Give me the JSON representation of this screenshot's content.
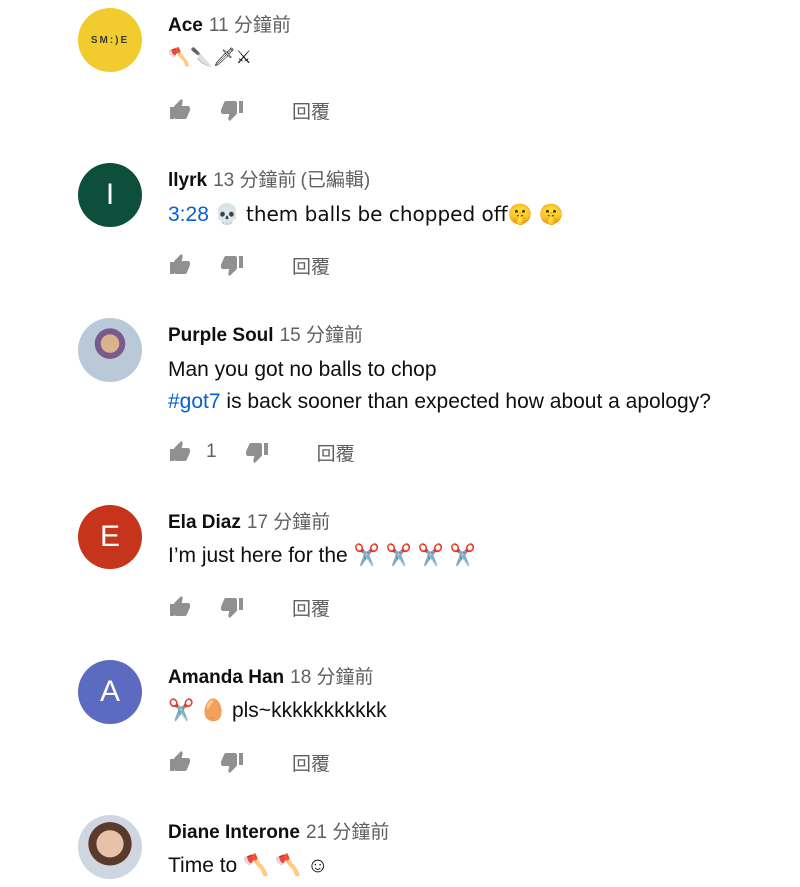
{
  "reply_label": "回覆",
  "comments": [
    {
      "author": "Ace",
      "time": "11 分鐘前",
      "edited": "",
      "avatar_text": "SM:)E",
      "avatar_color": "#f2cc2e",
      "text_line1": "🪓🔪🗡⚔",
      "like_count": ""
    },
    {
      "author": "llyrk",
      "time": "13 分鐘前",
      "edited": "(已編輯)",
      "avatar_text": "I",
      "avatar_color": "#0e4f3c",
      "timestamp_link": "3:28",
      "text_line1": "💀  them balls be chopped off🤫 🤫",
      "like_count": ""
    },
    {
      "author": "Purple Soul",
      "time": "15 分鐘前",
      "edited": "",
      "avatar_text": "",
      "text_line1": "Man you got no balls to chop",
      "hashtag": "#got7",
      "text_line2": " is back sooner than expected how about a apology?",
      "like_count": "1"
    },
    {
      "author": "Ela Diaz",
      "time": "17 分鐘前",
      "edited": "",
      "avatar_text": "E",
      "avatar_color": "#c6341c",
      "text_line1": "I’m just here for the ✂️ ✂️ ✂️ ✂️",
      "like_count": ""
    },
    {
      "author": "Amanda Han",
      "time": "18 分鐘前",
      "edited": "",
      "avatar_text": "A",
      "avatar_color": "#5c6bc0",
      "text_line1": "✂️ 🥚 pls~kkkkkkkkkkk",
      "like_count": ""
    },
    {
      "author": "Diane Interone",
      "time": "21 分鐘前",
      "edited": "",
      "avatar_text": "",
      "text_line1": "Time to 🪓 🪓 ☺",
      "like_count": ""
    }
  ]
}
